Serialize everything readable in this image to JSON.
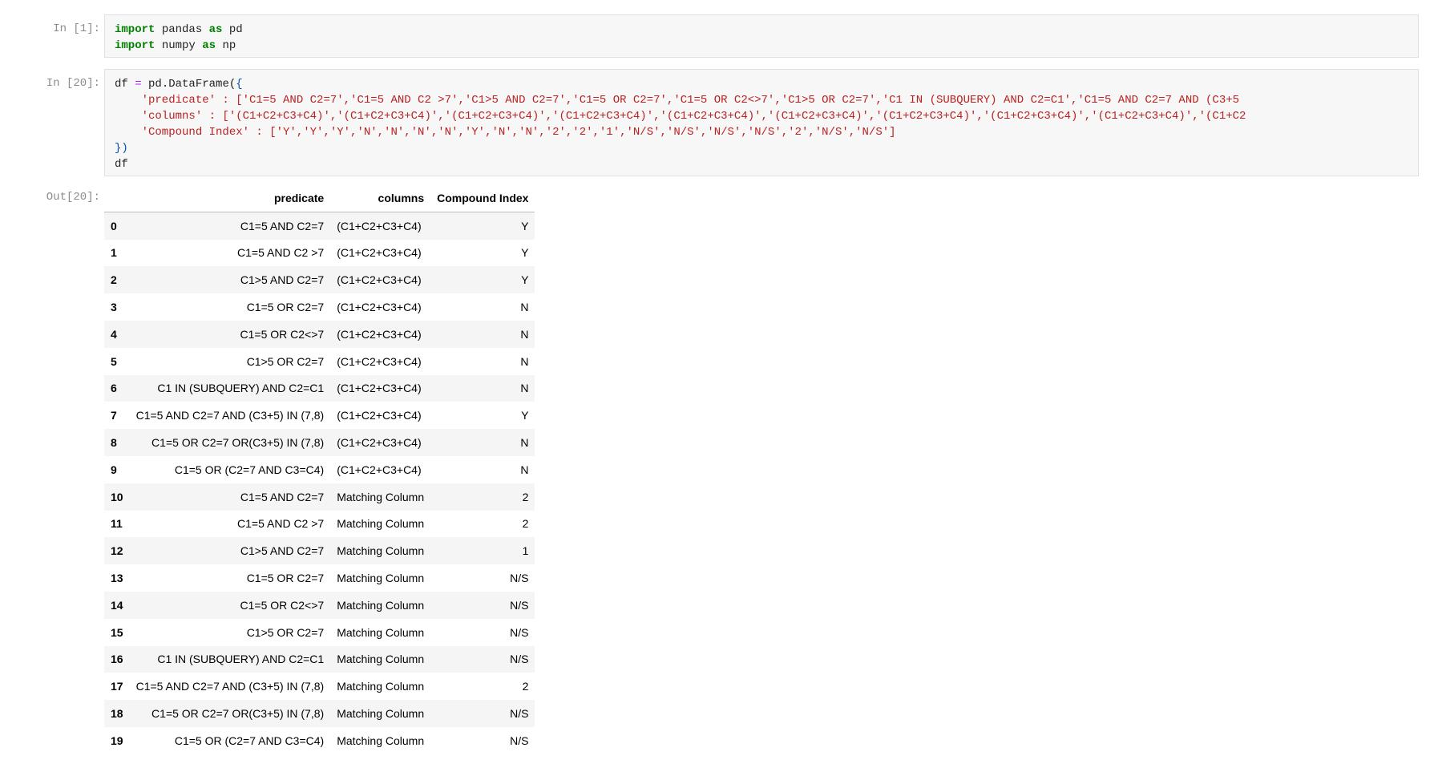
{
  "cells": {
    "in1": {
      "prompt": "In [1]:",
      "lines": [
        {
          "kw": "import",
          "mid": " pandas ",
          "kw2": "as",
          "rest": " pd"
        },
        {
          "kw": "import",
          "mid": " numpy ",
          "kw2": "as",
          "rest": " np"
        }
      ]
    },
    "in20": {
      "prompt": "In [20]:",
      "line1": {
        "a": "df ",
        "op": "=",
        "b": " pd.DataFrame(",
        "brace": "{"
      },
      "predicate_line": "    'predicate' : ['C1=5 AND C2=7','C1=5 AND C2 >7','C1>5 AND C2=7','C1=5 OR C2=7','C1=5 OR C2<>7','C1>5 OR C2=7','C1 IN (SUBQUERY) AND C2=C1','C1=5 AND C2=7 AND (C3+5",
      "columns_line": "    'columns' : ['(C1+C2+C3+C4)','(C1+C2+C3+C4)','(C1+C2+C3+C4)','(C1+C2+C3+C4)','(C1+C2+C3+C4)','(C1+C2+C3+C4)','(C1+C2+C3+C4)','(C1+C2+C3+C4)','(C1+C2+C3+C4)','(C1+C2",
      "compound_line": "    'Compound Index' : ['Y','Y','Y','N','N','N','N','Y','N','N','2','2','1','N/S','N/S','N/S','N/S','2','N/S','N/S']",
      "close_line": "})",
      "last_line": "df"
    },
    "out20": {
      "prompt": "Out[20]:"
    }
  },
  "table": {
    "headers": [
      "",
      "predicate",
      "columns",
      "Compound Index"
    ],
    "rows": [
      {
        "idx": "0",
        "predicate": "C1=5 AND C2=7",
        "columns": "(C1+C2+C3+C4)",
        "ci": "Y"
      },
      {
        "idx": "1",
        "predicate": "C1=5 AND C2 >7",
        "columns": "(C1+C2+C3+C4)",
        "ci": "Y"
      },
      {
        "idx": "2",
        "predicate": "C1>5 AND C2=7",
        "columns": "(C1+C2+C3+C4)",
        "ci": "Y"
      },
      {
        "idx": "3",
        "predicate": "C1=5 OR C2=7",
        "columns": "(C1+C2+C3+C4)",
        "ci": "N"
      },
      {
        "idx": "4",
        "predicate": "C1=5 OR C2<>7",
        "columns": "(C1+C2+C3+C4)",
        "ci": "N"
      },
      {
        "idx": "5",
        "predicate": "C1>5 OR C2=7",
        "columns": "(C1+C2+C3+C4)",
        "ci": "N"
      },
      {
        "idx": "6",
        "predicate": "C1 IN (SUBQUERY) AND C2=C1",
        "columns": "(C1+C2+C3+C4)",
        "ci": "N"
      },
      {
        "idx": "7",
        "predicate": "C1=5 AND C2=7 AND (C3+5) IN (7,8)",
        "columns": "(C1+C2+C3+C4)",
        "ci": "Y"
      },
      {
        "idx": "8",
        "predicate": "C1=5 OR C2=7 OR(C3+5) IN (7,8)",
        "columns": "(C1+C2+C3+C4)",
        "ci": "N"
      },
      {
        "idx": "9",
        "predicate": "C1=5 OR (C2=7 AND C3=C4)",
        "columns": "(C1+C2+C3+C4)",
        "ci": "N"
      },
      {
        "idx": "10",
        "predicate": "C1=5 AND C2=7",
        "columns": "Matching Column",
        "ci": "2"
      },
      {
        "idx": "11",
        "predicate": "C1=5 AND C2 >7",
        "columns": "Matching Column",
        "ci": "2"
      },
      {
        "idx": "12",
        "predicate": "C1>5 AND C2=7",
        "columns": "Matching Column",
        "ci": "1"
      },
      {
        "idx": "13",
        "predicate": "C1=5 OR C2=7",
        "columns": "Matching Column",
        "ci": "N/S"
      },
      {
        "idx": "14",
        "predicate": "C1=5 OR C2<>7",
        "columns": "Matching Column",
        "ci": "N/S"
      },
      {
        "idx": "15",
        "predicate": "C1>5 OR C2=7",
        "columns": "Matching Column",
        "ci": "N/S"
      },
      {
        "idx": "16",
        "predicate": "C1 IN (SUBQUERY) AND C2=C1",
        "columns": "Matching Column",
        "ci": "N/S"
      },
      {
        "idx": "17",
        "predicate": "C1=5 AND C2=7 AND (C3+5) IN (7,8)",
        "columns": "Matching Column",
        "ci": "2"
      },
      {
        "idx": "18",
        "predicate": "C1=5 OR C2=7 OR(C3+5) IN (7,8)",
        "columns": "Matching Column",
        "ci": "N/S"
      },
      {
        "idx": "19",
        "predicate": "C1=5 OR (C2=7 AND C3=C4)",
        "columns": "Matching Column",
        "ci": "N/S"
      }
    ]
  }
}
